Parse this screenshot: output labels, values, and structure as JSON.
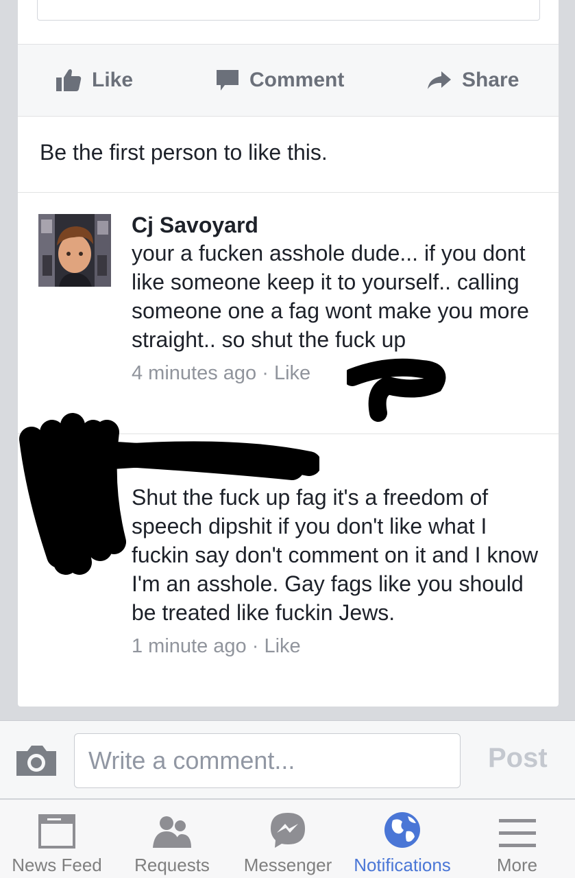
{
  "post": {
    "actions": {
      "like": "Like",
      "comment": "Comment",
      "share": "Share"
    },
    "likes_text": "Be the first person to like this."
  },
  "comments": [
    {
      "author": "Cj Savoyard",
      "text": "your a fucken asshole dude... if you dont like someone keep it to yourself.. calling someone one a fag wont make you more straight.. so shut the fuck up",
      "time": "4 minutes ago",
      "sep": " · ",
      "like": "Like"
    },
    {
      "author": "",
      "text": "Shut the fuck up fag it's a freedom of speech dipshit if you don't like what I fuckin say don't comment on it and I know I'm an asshole. Gay fags like you should be treated like fuckin Jews.",
      "time": "1 minute ago",
      "sep": " · ",
      "like": "Like"
    }
  ],
  "composer": {
    "placeholder": "Write a comment...",
    "post_label": "Post"
  },
  "tabbar": {
    "tabs": [
      {
        "label": "News Feed",
        "icon": "news-feed-icon"
      },
      {
        "label": "Requests",
        "icon": "friend-requests-icon"
      },
      {
        "label": "Messenger",
        "icon": "messenger-icon"
      },
      {
        "label": "Notifications",
        "icon": "globe-icon",
        "active": true
      },
      {
        "label": "More",
        "icon": "menu-icon"
      }
    ]
  },
  "colors": {
    "active_tab": "#4a76d6",
    "text": "#1d2129",
    "meta": "#90949c"
  }
}
